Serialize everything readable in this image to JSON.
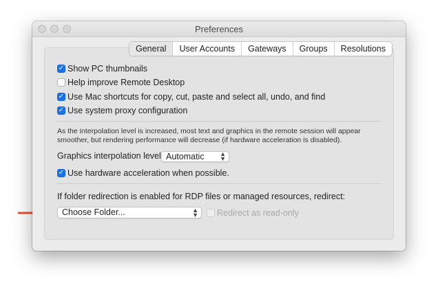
{
  "window": {
    "title": "Preferences"
  },
  "tabs": [
    {
      "label": "General",
      "selected": true
    },
    {
      "label": "User Accounts",
      "selected": false
    },
    {
      "label": "Gateways",
      "selected": false
    },
    {
      "label": "Groups",
      "selected": false
    },
    {
      "label": "Resolutions",
      "selected": false
    }
  ],
  "general": {
    "checkboxes": [
      {
        "label": "Show PC thumbnails",
        "checked": true
      },
      {
        "label": "Help improve Remote Desktop",
        "checked": false
      },
      {
        "label": "Use Mac shortcuts for copy, cut, paste and select all, undo, and find",
        "checked": true
      },
      {
        "label": "Use system proxy configuration",
        "checked": true
      }
    ],
    "interpolation_note": "As the interpolation level is increased, most text and graphics in the remote session will appear smoother, but rendering performance will decrease (if hardware acceleration is disabled).",
    "interpolation_label": "Graphics interpolation level:",
    "interpolation_value": "Automatic",
    "hardware_accel_label": "Use hardware acceleration when possible.",
    "hardware_accel_checked": true,
    "redirect_label": "If folder redirection is enabled for RDP files or managed resources, redirect:",
    "folder_popup_value": "Choose Folder...",
    "readonly_label": "Redirect as read-only",
    "readonly_checked": false,
    "readonly_enabled": false
  },
  "colors": {
    "accent": "#1a74e8",
    "arrow": "#f0502a"
  }
}
